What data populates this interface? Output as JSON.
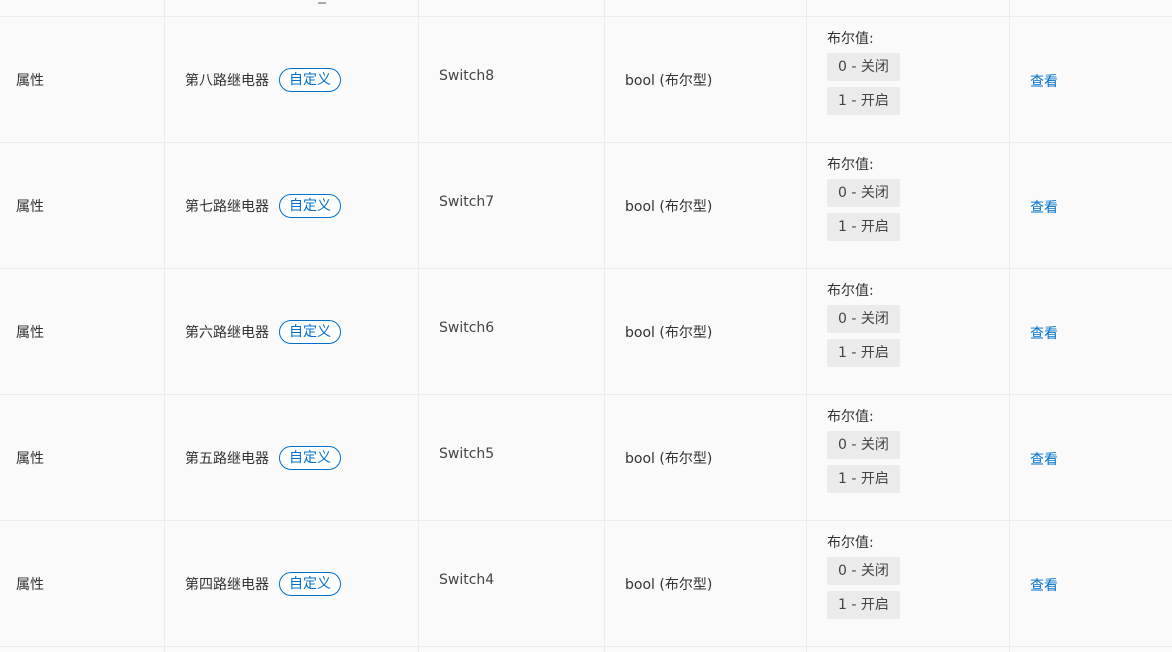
{
  "rows": [
    {
      "kind": "属性",
      "name": "第八路继电器",
      "tag": "自定义",
      "identifier": "Switch8",
      "datatype": "bool (布尔型)",
      "bool_title": "布尔值:",
      "bool_values": [
        "0 - 关闭",
        "1 - 开启"
      ],
      "action": "查看"
    },
    {
      "kind": "属性",
      "name": "第七路继电器",
      "tag": "自定义",
      "identifier": "Switch7",
      "datatype": "bool (布尔型)",
      "bool_title": "布尔值:",
      "bool_values": [
        "0 - 关闭",
        "1 - 开启"
      ],
      "action": "查看"
    },
    {
      "kind": "属性",
      "name": "第六路继电器",
      "tag": "自定义",
      "identifier": "Switch6",
      "datatype": "bool (布尔型)",
      "bool_title": "布尔值:",
      "bool_values": [
        "0 - 关闭",
        "1 - 开启"
      ],
      "action": "查看"
    },
    {
      "kind": "属性",
      "name": "第五路继电器",
      "tag": "自定义",
      "identifier": "Switch5",
      "datatype": "bool (布尔型)",
      "bool_title": "布尔值:",
      "bool_values": [
        "0 - 关闭",
        "1 - 开启"
      ],
      "action": "查看"
    },
    {
      "kind": "属性",
      "name": "第四路继电器",
      "tag": "自定义",
      "identifier": "Switch4",
      "datatype": "bool (布尔型)",
      "bool_title": "布尔值:",
      "bool_values": [
        "0 - 关闭",
        "1 - 开启"
      ],
      "action": "查看"
    }
  ],
  "colors": {
    "link": "#0070cc",
    "tag_border": "#0070cc",
    "row_bg": "#fafafa",
    "border": "#ececec",
    "chip_bg": "#ebebeb"
  }
}
